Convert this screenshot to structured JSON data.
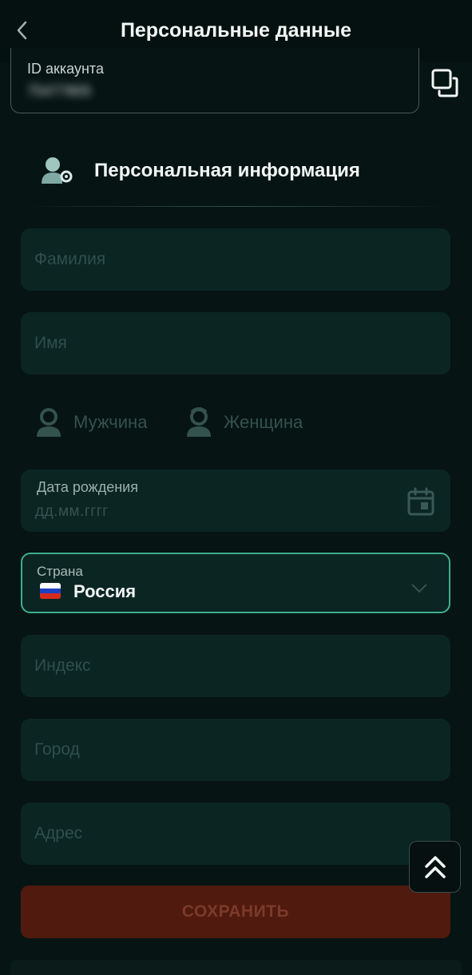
{
  "header": {
    "title": "Персональные данные"
  },
  "account": {
    "label": "ID аккаунта",
    "value": "75477805"
  },
  "section": {
    "title": "Персональная информация"
  },
  "fields": {
    "surname_placeholder": "Фамилия",
    "name_placeholder": "Имя",
    "birth_label": "Дата рождения",
    "birth_placeholder": "дд.мм.гггг",
    "country_label": "Страна",
    "country_value": "Россия",
    "postcode_placeholder": "Индекс",
    "city_placeholder": "Город",
    "address_placeholder": "Адрес"
  },
  "gender": {
    "male": "Мужчина",
    "female": "Женщина"
  },
  "actions": {
    "save": "СОХРАНИТЬ"
  },
  "colors": {
    "background": "#061413",
    "field": "#0b2523",
    "accent": "#3fae8c",
    "save_button": "#501a0e"
  },
  "icons": [
    "back-arrow-icon",
    "copy-icon",
    "user-settings-icon",
    "male-user-icon",
    "female-user-icon",
    "calendar-icon",
    "russia-flag-icon",
    "chevron-down-icon",
    "double-chevron-up-icon"
  ]
}
